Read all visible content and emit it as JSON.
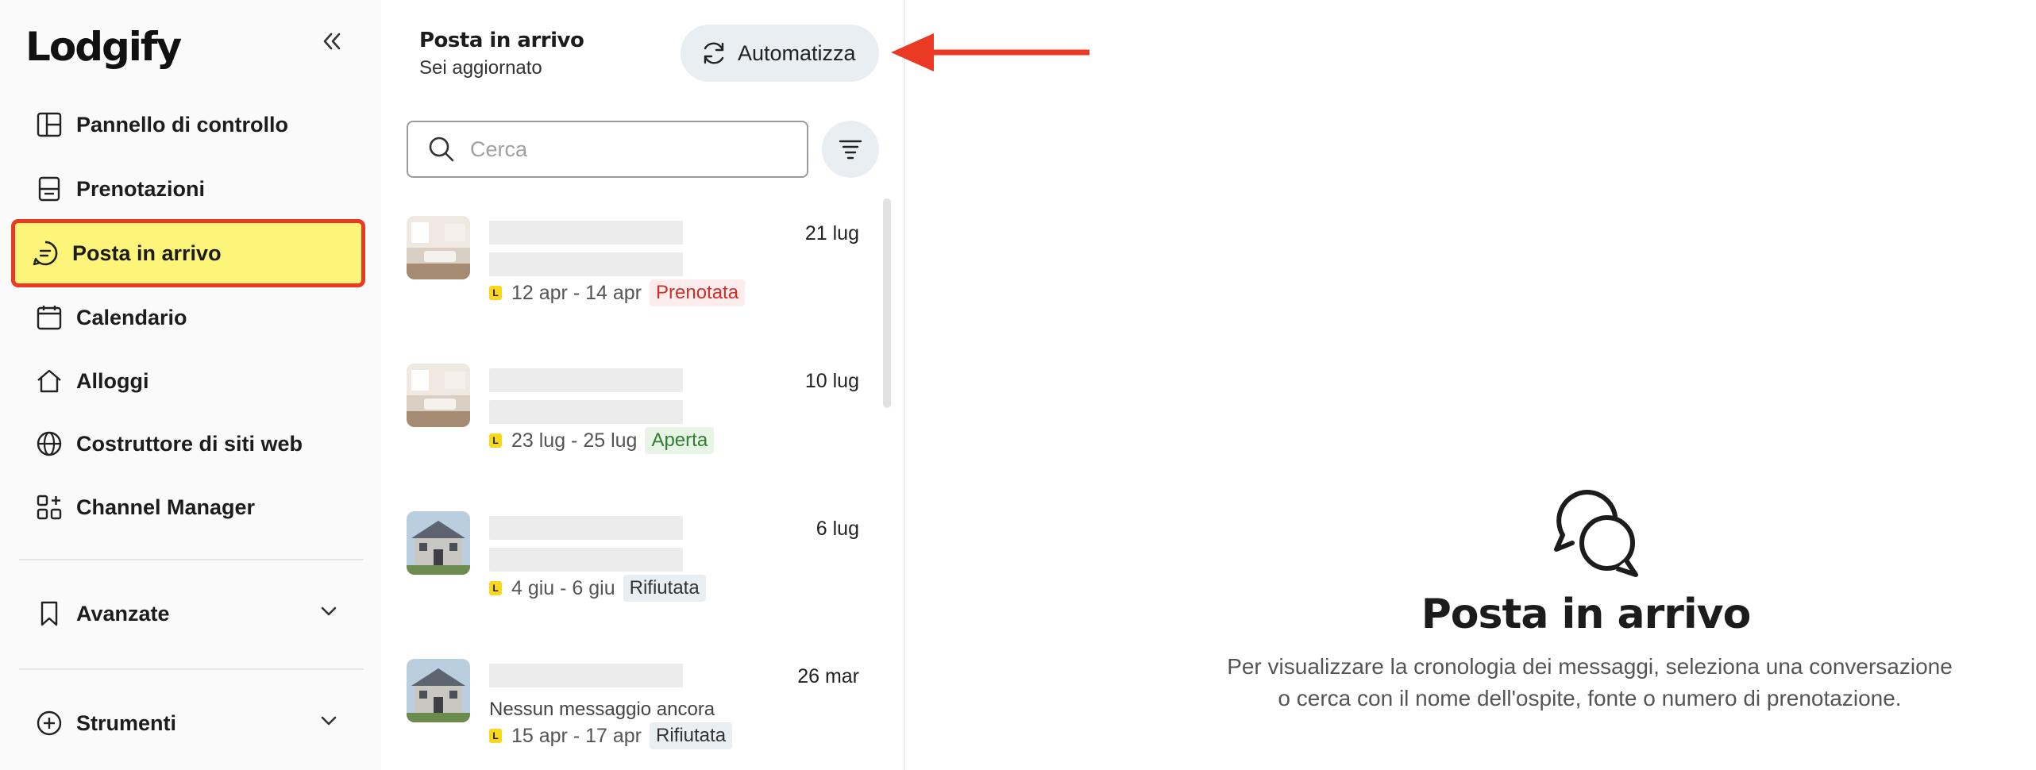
{
  "sidebar": {
    "logo": "Lodgify",
    "nav": [
      {
        "label": "Pannello di controllo",
        "icon": "dashboard-icon"
      },
      {
        "label": "Prenotazioni",
        "icon": "bookings-icon"
      },
      {
        "label": "Posta in arrivo",
        "icon": "chat-icon",
        "active": true
      },
      {
        "label": "Calendario",
        "icon": "calendar-icon"
      },
      {
        "label": "Alloggi",
        "icon": "home-icon"
      },
      {
        "label": "Costruttore di siti web",
        "icon": "globe-icon"
      },
      {
        "label": "Channel Manager",
        "icon": "channel-icon"
      }
    ],
    "sections": [
      {
        "label": "Avanzate",
        "icon": "bookmark-icon"
      },
      {
        "label": "Strumenti",
        "icon": "plus-circle-icon"
      }
    ]
  },
  "inbox": {
    "title": "Posta in arrivo",
    "subtitle": "Sei aggiornato",
    "automate_label": "Automatizza",
    "search_placeholder": "Cerca",
    "conversations": [
      {
        "date": "21 lug",
        "range": "12 apr - 14 apr",
        "status": "Prenotata",
        "message": "",
        "thumb": "interior"
      },
      {
        "date": "10 lug",
        "range": "23 lug - 25 lug",
        "status": "Aperta",
        "message": "",
        "thumb": "interior"
      },
      {
        "date": "6 lug",
        "range": "4 giu - 6 giu",
        "status": "Rifiutata",
        "message": "",
        "thumb": "house"
      },
      {
        "date": "26 mar",
        "range": "15 apr - 17 apr",
        "status": "Rifiutata",
        "message": "Nessun messaggio ancora",
        "thumb": "house"
      }
    ]
  },
  "empty_state": {
    "title": "Posta in arrivo",
    "line1": "Per visualizzare la cronologia dei messaggi, seleziona una conversazione",
    "line2": "o cerca con il nome dell'ospite, fonte o numero di prenotazione."
  },
  "colors": {
    "highlight": "#fdf47a",
    "annotation": "#ea3a24",
    "status_booked": "#c8312a",
    "status_open": "#2e7d32",
    "status_declined": "#333333"
  }
}
